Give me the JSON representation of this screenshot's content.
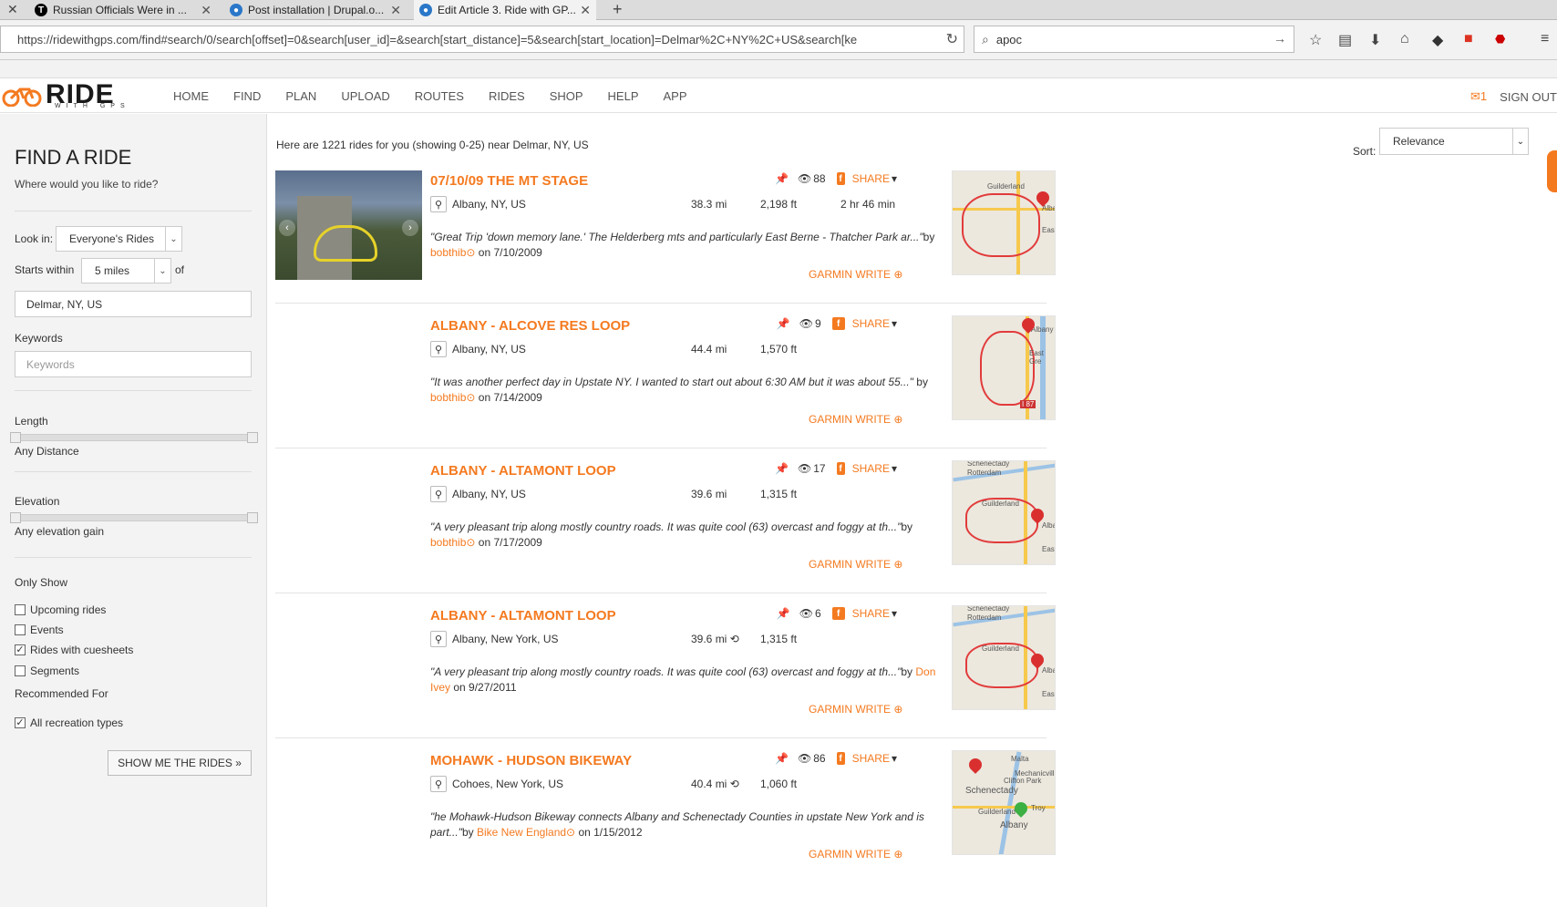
{
  "browser": {
    "tabs": [
      {
        "title": "Russian Officials Were in ...",
        "icon": "nyt-icon"
      },
      {
        "title": "Post installation | Drupal.o...",
        "icon": "drupal-icon"
      },
      {
        "title": "Edit Article 3. Ride with GP...",
        "icon": "drupal-icon"
      }
    ],
    "url": "https://ridewithgps.com/find#search/0/search[offset]=0&search[user_id]=&search[start_distance]=5&search[start_location]=Delmar%2C+NY%2C+US&search[ke",
    "search_value": "apoc"
  },
  "site": {
    "logo_text": "RIDE",
    "logo_sub": "WITH GPS",
    "menu": [
      "HOME",
      "FIND",
      "PLAN",
      "UPLOAD",
      "ROUTES",
      "RIDES",
      "SHOP",
      "HELP",
      "APP"
    ],
    "mail_count": "1",
    "sign_out": "SIGN OUT"
  },
  "sidebar": {
    "title": "FIND A RIDE",
    "subtitle": "Where would you like to ride?",
    "look_in_label": "Look in:",
    "look_in_value": "Everyone's Rides",
    "starts_within_label": "Starts within",
    "starts_within_value": "5 miles",
    "of_label": "of",
    "location_value": "Delmar, NY, US",
    "keywords_label": "Keywords",
    "keywords_placeholder": "Keywords",
    "length_label": "Length",
    "length_value": "Any Distance",
    "elevation_label": "Elevation",
    "elevation_value": "Any elevation gain",
    "only_show_label": "Only Show",
    "only_show": [
      {
        "label": "Upcoming rides",
        "checked": false
      },
      {
        "label": "Events",
        "checked": false
      },
      {
        "label": "Rides with cuesheets",
        "checked": true
      },
      {
        "label": "Segments",
        "checked": false
      }
    ],
    "recommended_label": "Recommended For",
    "recommended": {
      "label": "All recreation types",
      "checked": true
    },
    "show_button": "SHOW ME THE RIDES »"
  },
  "results": {
    "count_text": "Here are 1221 rides for you (showing 0-25) near Delmar, NY, US",
    "sort_label": "Sort:",
    "sort_value": "Relevance",
    "rides": [
      {
        "title": "07/10/09 THE MT STAGE",
        "location": "Albany, NY, US",
        "distance": "38.3 mi",
        "elevation": "2,198 ft",
        "duration": "2 hr 46 min",
        "views": "88",
        "share": "SHARE",
        "desc": "\"Great Trip 'down memory lane.' The Helderberg mts and particularly East Berne - Thatcher Park ar...\"",
        "by": "by",
        "user": "bobthib",
        "date": "on 7/10/2009",
        "garmin": "GARMIN WRITE",
        "has_photo": true,
        "loop_icon": false
      },
      {
        "title": "ALBANY - ALCOVE RES LOOP",
        "location": "Albany, NY, US",
        "distance": "44.4 mi",
        "elevation": "1,570 ft",
        "duration": "",
        "views": "9",
        "share": "SHARE",
        "desc": "\"It was another perfect day in Upstate NY. I wanted to start out about 6:30 AM but it was about 55...\"",
        "by": "by",
        "user": "bobthib",
        "date": "on 7/14/2009",
        "garmin": "GARMIN WRITE",
        "has_photo": false,
        "loop_icon": false
      },
      {
        "title": "ALBANY - ALTAMONT LOOP",
        "location": "Albany, NY, US",
        "distance": "39.6 mi",
        "elevation": "1,315 ft",
        "duration": "",
        "views": "17",
        "share": "SHARE",
        "desc": "\"A very pleasant trip along mostly country roads. It was quite cool (63) overcast and foggy at th...\"",
        "by": "by",
        "user": "bobthib",
        "date": "on 7/17/2009",
        "garmin": "GARMIN WRITE",
        "has_photo": false,
        "loop_icon": false
      },
      {
        "title": "ALBANY - ALTAMONT LOOP",
        "location": "Albany, New York, US",
        "distance": "39.6 mi",
        "elevation": "1,315 ft",
        "duration": "",
        "views": "6",
        "share": "SHARE",
        "desc": "\"A very pleasant trip along mostly country roads. It was quite cool (63) overcast and foggy at th...\"",
        "by": "by",
        "user": "Don Ivey",
        "date": "on 9/27/2011",
        "garmin": "GARMIN WRITE",
        "has_photo": false,
        "loop_icon": true
      },
      {
        "title": "MOHAWK - HUDSON BIKEWAY",
        "location": "Cohoes, New York, US",
        "distance": "40.4 mi",
        "elevation": "1,060 ft",
        "duration": "",
        "views": "86",
        "share": "SHARE",
        "desc": "\"he Mohawk-Hudson Bikeway connects Albany and Schenectady Counties in upstate New York and is part...\"",
        "by": "by",
        "user": "Bike New England",
        "date": "on 1/15/2012",
        "garmin": "GARMIN WRITE",
        "has_photo": false,
        "loop_icon": true
      }
    ],
    "map_labels": [
      [
        "Guilderland",
        "Alba",
        "East"
      ],
      [
        "Albany",
        "East Gre",
        "I 87"
      ],
      [
        "Schenectady",
        "Rotterdam",
        "Guilderland",
        "Alba",
        "East"
      ],
      [
        "Schenectady",
        "Rotterdam",
        "Guilderland",
        "Alba",
        "East"
      ],
      [
        "Malta",
        "Mechanicville",
        "Clifton Park",
        "Schenectady",
        "Guilderland",
        "Troy",
        "Albany"
      ]
    ]
  }
}
